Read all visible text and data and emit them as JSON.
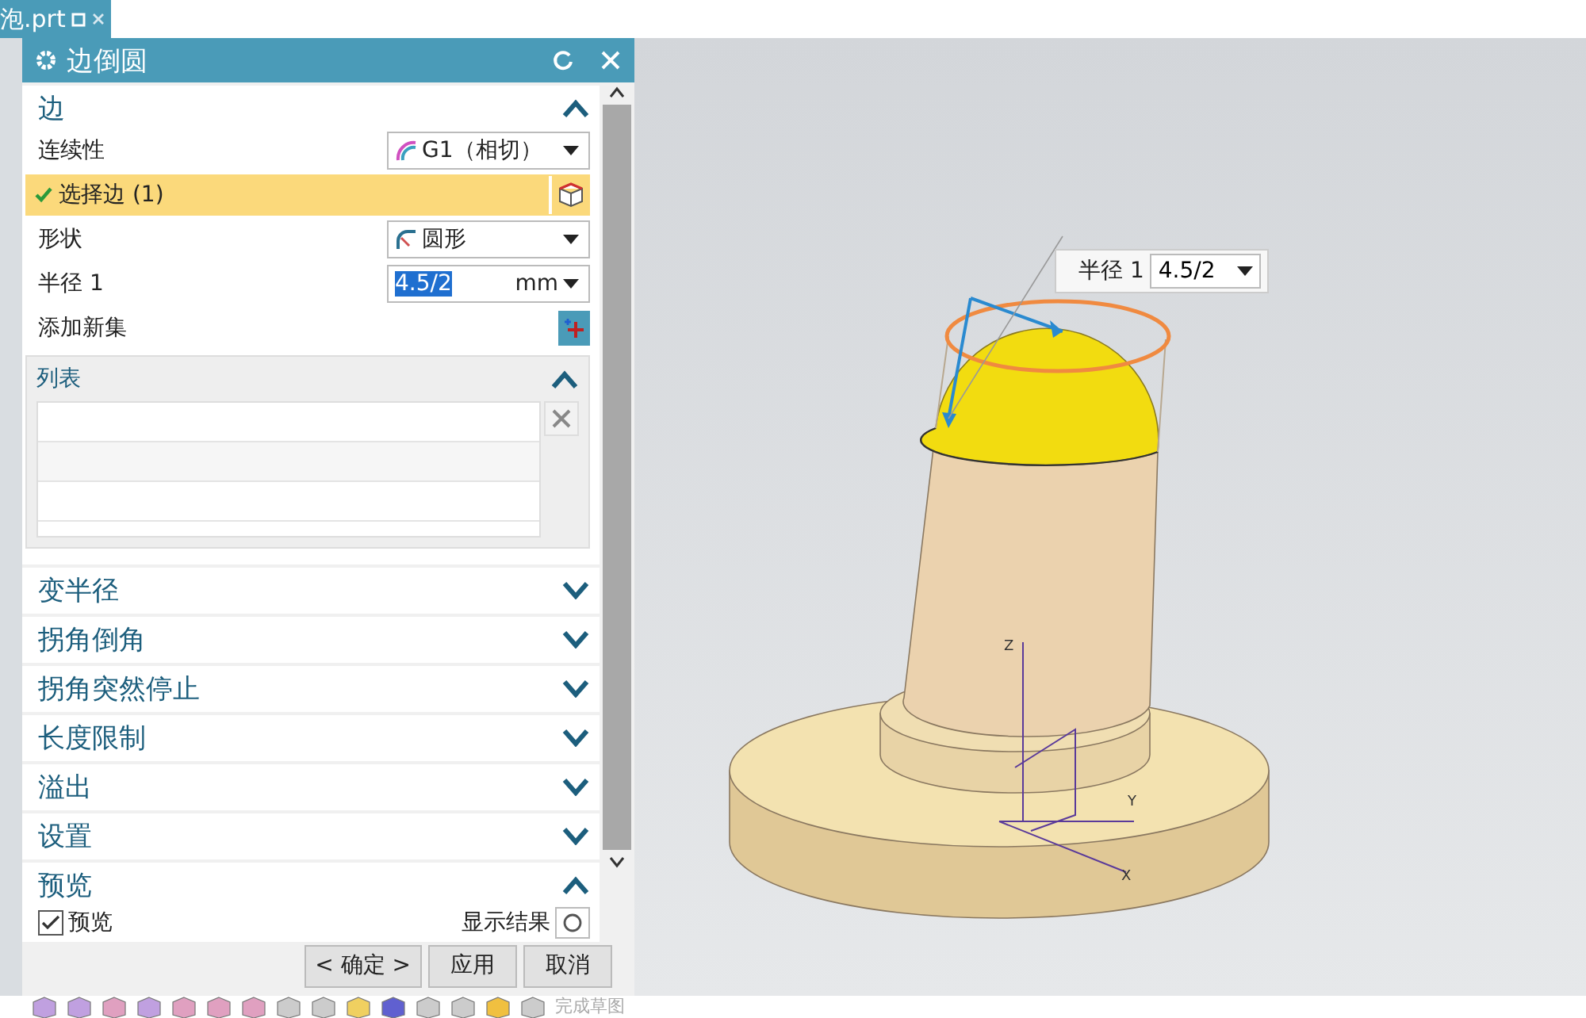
{
  "tab": {
    "label": "泡.prt"
  },
  "dialog": {
    "title": "边倒圆",
    "sections": [
      {
        "kind": "edge",
        "title": "边",
        "expanded": true,
        "continuity": {
          "label": "连续性",
          "value": "G1（相切）"
        },
        "select": {
          "label": "选择边 (1)",
          "done": true
        },
        "shape": {
          "label": "形状",
          "value": "圆形"
        },
        "radius": {
          "label": "半径 1",
          "value": "4.5/2",
          "unit": "mm"
        },
        "add_set": {
          "label": "添加新集"
        },
        "list": {
          "title": "列表",
          "expanded": true
        }
      },
      {
        "kind": "plain",
        "title": "变半径",
        "expanded": false
      },
      {
        "kind": "plain",
        "title": "拐角倒角",
        "expanded": false
      },
      {
        "kind": "plain",
        "title": "拐角突然停止",
        "expanded": false
      },
      {
        "kind": "plain",
        "title": "长度限制",
        "expanded": false
      },
      {
        "kind": "plain",
        "title": "溢出",
        "expanded": false
      },
      {
        "kind": "plain",
        "title": "设置",
        "expanded": false
      },
      {
        "kind": "preview",
        "title": "预览",
        "expanded": true,
        "checkbox": {
          "label": "预览",
          "checked": true
        },
        "result_button": {
          "label": "显示结果"
        }
      }
    ],
    "buttons": [
      {
        "label": "< 确定 >"
      },
      {
        "label": "应用"
      },
      {
        "label": "取消"
      }
    ]
  },
  "viewport": {
    "radius_callout": {
      "label": "半径 1",
      "value": "4.5/2"
    },
    "axes": [
      "Z",
      "Y",
      "X"
    ]
  },
  "toolbar": {
    "disabled_label": "完成草图"
  }
}
